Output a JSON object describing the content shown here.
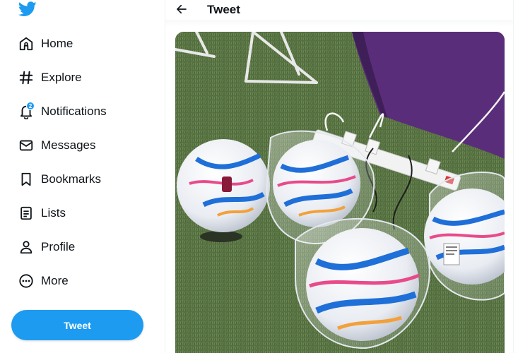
{
  "sidebar": {
    "items": [
      {
        "label": "Home",
        "icon": "home-icon"
      },
      {
        "label": "Explore",
        "icon": "hashtag-icon"
      },
      {
        "label": "Notifications",
        "icon": "bell-icon",
        "badge": "2"
      },
      {
        "label": "Messages",
        "icon": "envelope-icon"
      },
      {
        "label": "Bookmarks",
        "icon": "bookmark-icon"
      },
      {
        "label": "Lists",
        "icon": "list-icon"
      },
      {
        "label": "Profile",
        "icon": "person-icon"
      },
      {
        "label": "More",
        "icon": "more-circle-icon"
      }
    ],
    "tweet_button": "Tweet"
  },
  "header": {
    "title": "Tweet"
  },
  "colors": {
    "brand": "#1d9bf0",
    "text": "#0f1419"
  }
}
